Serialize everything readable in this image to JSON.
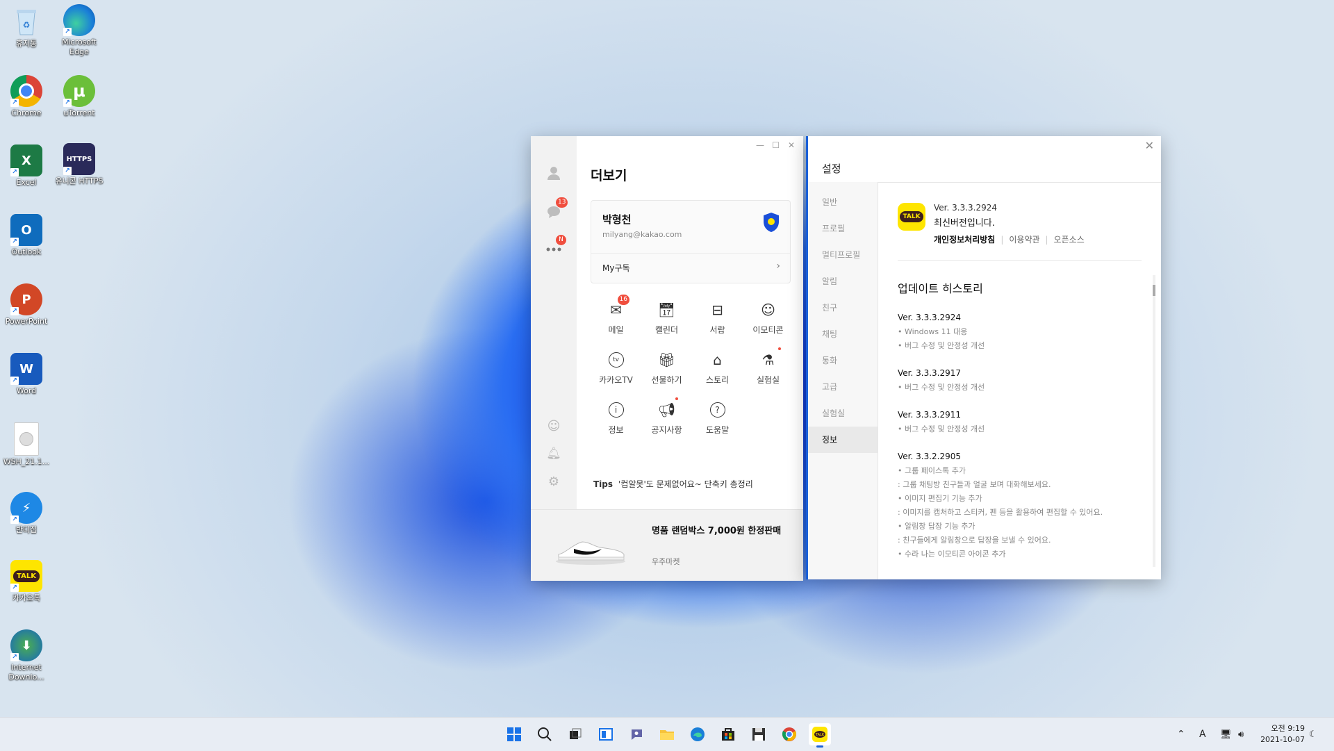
{
  "desktop": {
    "icons": [
      {
        "label": "휴지통",
        "icon": "recycle-bin-icon"
      },
      {
        "label": "Microsoft Edge",
        "icon": "edge-icon"
      },
      {
        "label": "Chrome",
        "icon": "chrome-icon"
      },
      {
        "label": "uTorrent",
        "icon": "utorrent-icon"
      },
      {
        "label": "Excel",
        "icon": "excel-icon"
      },
      {
        "label": "유니콘 HTTPS",
        "icon": "unicorn-https-icon"
      },
      {
        "label": "Outlook",
        "icon": "outlook-icon"
      },
      {
        "label": "PowerPoint",
        "icon": "powerpoint-icon"
      },
      {
        "label": "Word",
        "icon": "word-icon"
      },
      {
        "label": "WSH_21.1...",
        "icon": "file-icon"
      },
      {
        "label": "반디집",
        "icon": "bandizip-icon"
      },
      {
        "label": "카카오톡",
        "icon": "kakaotalk-icon"
      },
      {
        "label": "Internet Downlo...",
        "icon": "idm-icon"
      }
    ]
  },
  "more_window": {
    "title": "더보기",
    "nav_badges": {
      "chat": "13",
      "more": "N"
    },
    "profile": {
      "name": "박형천",
      "email": "milyang@kakao.com",
      "my_sub": "My구독"
    },
    "grid": [
      {
        "label": "메일",
        "icon": "mail-icon",
        "badge": "16"
      },
      {
        "label": "캘린더",
        "icon": "calendar-icon"
      },
      {
        "label": "서랍",
        "icon": "drawer-icon"
      },
      {
        "label": "이모티콘",
        "icon": "emoticon-icon"
      },
      {
        "label": "카카오TV",
        "icon": "kakaotv-icon"
      },
      {
        "label": "선물하기",
        "icon": "gift-icon"
      },
      {
        "label": "스토리",
        "icon": "story-icon"
      },
      {
        "label": "실험실",
        "icon": "lab-icon"
      },
      {
        "label": "정보",
        "icon": "info-icon"
      },
      {
        "label": "공지사항",
        "icon": "notice-icon"
      },
      {
        "label": "도움말",
        "icon": "help-icon"
      }
    ],
    "tips": {
      "label": "Tips",
      "text": "'컴알못'도 문제없어요~ 단축키 총정리"
    },
    "ad": {
      "title": "명품 랜덤박스 7,000원 한정판매",
      "source": "우주마켓"
    }
  },
  "settings_window": {
    "title": "설정",
    "nav": [
      "일반",
      "프로필",
      "멀티프로필",
      "알림",
      "친구",
      "채팅",
      "통화",
      "고급",
      "실험실",
      "정보"
    ],
    "active_nav": "정보",
    "version_line": "Ver. 3.3.3.2924",
    "latest_text": "최신버전입니다.",
    "links": [
      "개인정보처리방침",
      "이용약관",
      "오픈소스"
    ],
    "history_title": "업데이트 히스토리",
    "history": [
      {
        "version": "Ver. 3.3.3.2924",
        "lines": [
          "• Windows 11 대응",
          "• 버그 수정 및 안정성 개선"
        ]
      },
      {
        "version": "Ver. 3.3.3.2917",
        "lines": [
          "• 버그 수정 및 안정성 개선"
        ]
      },
      {
        "version": "Ver. 3.3.3.2911",
        "lines": [
          "• 버그 수정 및 안정성 개선"
        ]
      },
      {
        "version": "Ver. 3.3.2.2905",
        "lines": [
          "• 그룹 페이스톡 추가",
          ": 그룹 채팅방 친구들과 얼굴 보며 대화해보세요.",
          "• 이미지 편집기 기능 추가",
          ": 이미지를 캡처하고 스티커, 펜 등을 활용하여 편집할 수 있어요.",
          "• 알림창 답장 기능 추가",
          ": 친구들에게 알림창으로 답장을 보낼 수 있어요.",
          "• 수라 나는 이모티콘 아이콘 추가"
        ]
      }
    ]
  },
  "taskbar": {
    "apps": [
      "start-icon",
      "search-icon",
      "task-view-icon",
      "widgets-icon",
      "teams-chat-icon",
      "file-explorer-icon",
      "edge-icon",
      "store-icon",
      "save-icon",
      "chrome-icon",
      "kakaotalk-icon"
    ],
    "active": "kakaotalk-icon",
    "ime": "A",
    "time": "오전 9:19",
    "date": "2021-10-07"
  }
}
